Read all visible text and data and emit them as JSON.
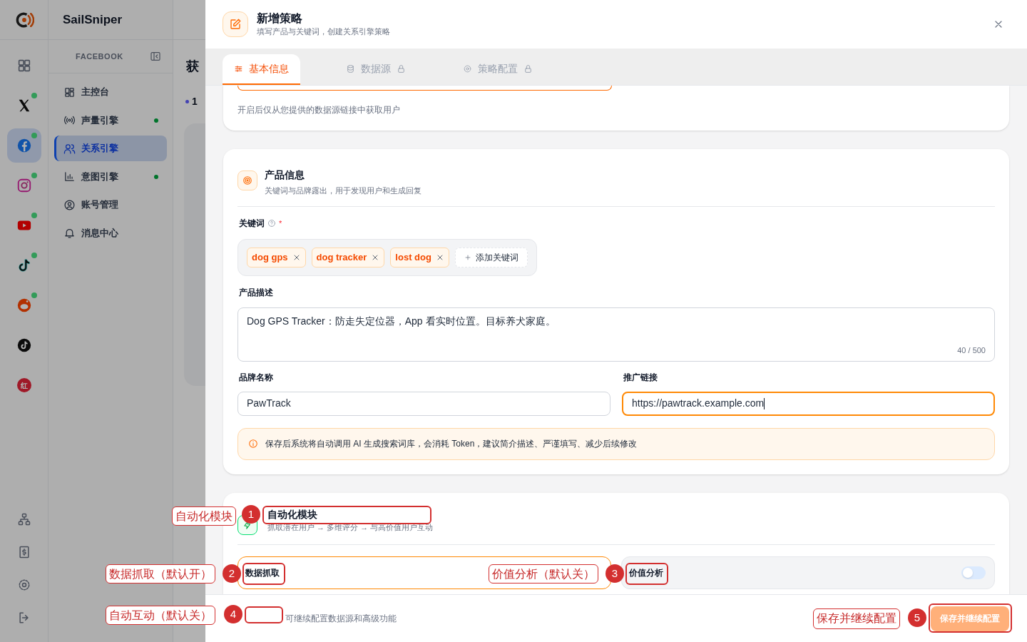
{
  "app": {
    "brand": "SailSniper",
    "rail": [
      {
        "kind": "grid",
        "selected": false,
        "online": false
      },
      {
        "kind": "x",
        "selected": false,
        "online": true
      },
      {
        "kind": "facebook",
        "selected": true,
        "online": true
      },
      {
        "kind": "instagram",
        "selected": false,
        "online": true
      },
      {
        "kind": "youtube",
        "selected": false,
        "online": true
      },
      {
        "kind": "tiktok",
        "selected": false,
        "online": true
      },
      {
        "kind": "reddit",
        "selected": false,
        "online": true
      },
      {
        "kind": "tiktok-badge",
        "selected": false,
        "online": false
      },
      {
        "kind": "xiaohongshu",
        "text": "红",
        "selected": false,
        "online": false
      }
    ],
    "rail_bottom": [
      {
        "kind": "sitemap"
      },
      {
        "kind": "dollar"
      },
      {
        "kind": "settings"
      },
      {
        "kind": "logout"
      }
    ],
    "nav_header": "FACEBOOK",
    "nav": [
      {
        "kind": "dashboard",
        "label": "主控台",
        "selected": false,
        "status": false
      },
      {
        "kind": "broadcast",
        "label": "声量引擎",
        "selected": false,
        "status": true
      },
      {
        "kind": "users",
        "label": "关系引擎",
        "selected": true,
        "status": false
      },
      {
        "kind": "chart",
        "label": "意图引擎",
        "selected": false,
        "status": true
      },
      {
        "kind": "account",
        "label": "账号管理",
        "selected": false,
        "status": false
      },
      {
        "kind": "bell",
        "label": "消息中心",
        "selected": false,
        "status": false
      }
    ],
    "page_title": "获",
    "step_marker": "1"
  },
  "drawer": {
    "title": "新增策略",
    "subtitle": "填写产品与关键词，创建关系引擎策略",
    "tabs": [
      {
        "kind": "basic",
        "label": "基本信息",
        "selected": true,
        "locked": false
      },
      {
        "kind": "datasource",
        "label": "数据源",
        "selected": false,
        "locked": true
      },
      {
        "kind": "strategy",
        "label": "策略配置",
        "selected": false,
        "locked": true
      }
    ],
    "source_hint": "开启后仅从您提供的数据源链接中获取用户",
    "product": {
      "title": "产品信息",
      "subtitle": "关键词与品牌露出，用于发现用户和生成回复",
      "keywords_label": "关键词",
      "required_mark": "*",
      "keywords": [
        "dog gps",
        "dog tracker",
        "lost dog"
      ],
      "add_keyword": "添加关键词",
      "description_label": "产品描述",
      "description": "Dog GPS Tracker：防走失定位器，App 看实时位置。目标养犬家庭。",
      "char_count": "40 / 500",
      "fields": [
        {
          "label": "品牌名称",
          "value": "PawTrack",
          "focused": false
        },
        {
          "label": "推广链接",
          "value": "https://pawtrack.example.com",
          "focused": true
        }
      ],
      "notice": "保存后系统将自动调用 AI 生成搜索词库，会消耗 Token，建议简介描述、严谨填写、减少后续修改"
    },
    "automation": {
      "title": "自动化模块",
      "subtitle": "抓取潜在用户 → 多维评分 → 与高价值用户互动",
      "modules": [
        {
          "label": "数据抓取",
          "on": true
        },
        {
          "label": "价值分析",
          "on": false
        }
      ]
    },
    "footer_hint": "可继续配置数据源和高级功能",
    "save_button": "保存并继续配置"
  },
  "annotations": [
    {
      "number": "1",
      "label": "自动化模块"
    },
    {
      "number": "2",
      "label": "数据抓取（默认开）"
    },
    {
      "number": "3",
      "label": "价值分析（默认关）"
    },
    {
      "number": "4",
      "label": "自动互动（默认关）"
    },
    {
      "number": "5",
      "label": "保存并继续配置"
    }
  ]
}
